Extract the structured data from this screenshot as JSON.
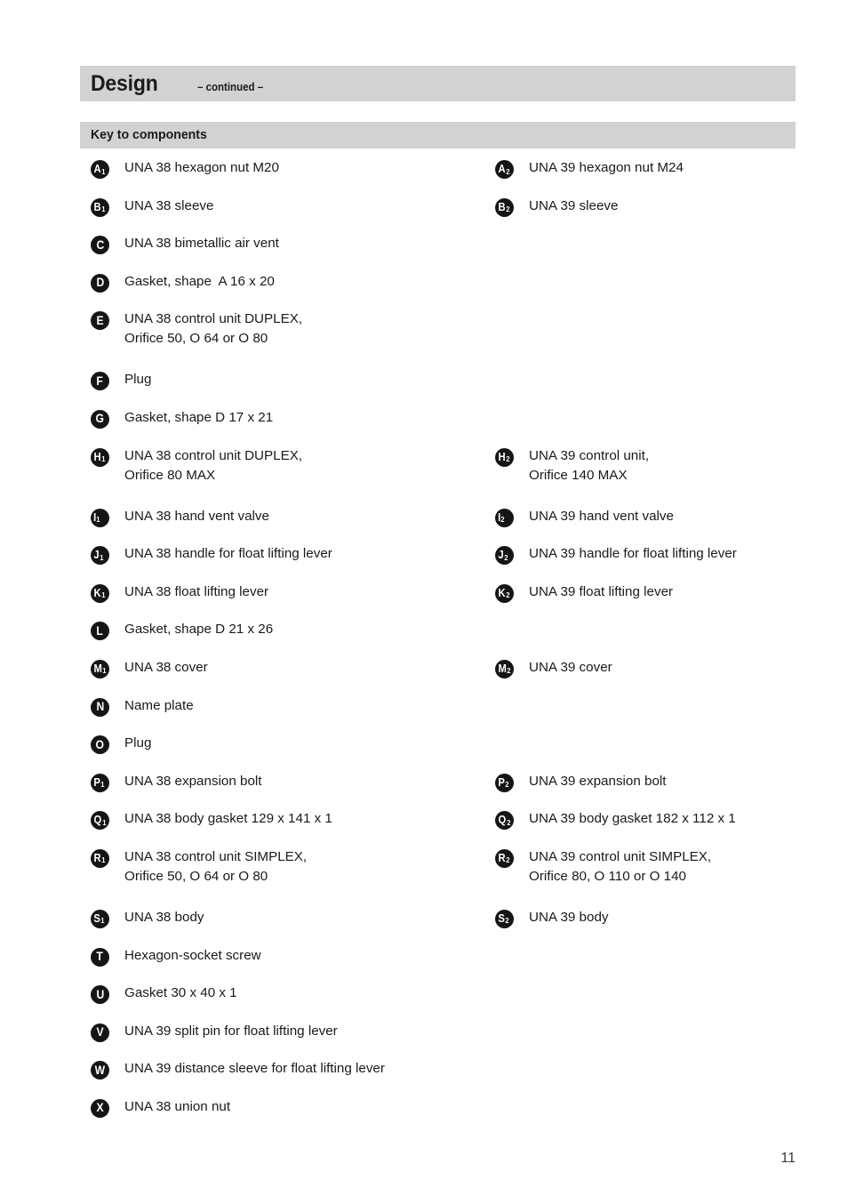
{
  "header": {
    "title": "Design",
    "continued": "– continued –",
    "section_title": "Key to components",
    "band_color": "#d2d2d2"
  },
  "footer": {
    "page_number": "11"
  },
  "key_to_components": {
    "rows": [
      {
        "left": {
          "letter": "A",
          "sub": "1",
          "lines": [
            "UNA 38 hexagon nut M20"
          ]
        },
        "right": {
          "letter": "A",
          "sub": "2",
          "lines": [
            "UNA 39 hexagon nut M24"
          ]
        }
      },
      {
        "left": {
          "letter": "B",
          "sub": "1",
          "lines": [
            "UNA 38 sleeve"
          ]
        },
        "right": {
          "letter": "B",
          "sub": "2",
          "lines": [
            "UNA 39 sleeve"
          ]
        }
      },
      {
        "left": {
          "letter": "C",
          "sub": "",
          "lines": [
            "UNA 38 bimetallic air vent"
          ]
        },
        "right": null
      },
      {
        "left": {
          "letter": "D",
          "sub": "",
          "lines": [
            "Gasket, shape  A 16 x 20"
          ]
        },
        "right": null
      },
      {
        "left": {
          "letter": "E",
          "sub": "",
          "lines": [
            "UNA 38 control unit DUPLEX,",
            "Orifice 50, O 64 or O 80"
          ]
        },
        "right": null
      },
      {
        "left": {
          "letter": "F",
          "sub": "",
          "lines": [
            "Plug"
          ]
        },
        "right": null
      },
      {
        "left": {
          "letter": "G",
          "sub": "",
          "lines": [
            "Gasket, shape D 17 x 21"
          ]
        },
        "right": null
      },
      {
        "left": {
          "letter": "H",
          "sub": "1",
          "lines": [
            "UNA 38 control unit DUPLEX,",
            "Orifice 80 MAX"
          ]
        },
        "right": {
          "letter": "H",
          "sub": "2",
          "lines": [
            "UNA 39 control unit,",
            "Orifice 140 MAX"
          ]
        }
      },
      {
        "left": {
          "letter": "I",
          "sub": "1",
          "lines": [
            "UNA 38 hand vent valve"
          ]
        },
        "right": {
          "letter": "I",
          "sub": "2",
          "lines": [
            "UNA 39 hand vent valve"
          ]
        }
      },
      {
        "left": {
          "letter": "J",
          "sub": "1",
          "lines": [
            "UNA 38 handle for float lifting lever"
          ]
        },
        "right": {
          "letter": "J",
          "sub": "2",
          "lines": [
            "UNA 39 handle for float lifting lever"
          ]
        }
      },
      {
        "left": {
          "letter": "K",
          "sub": "1",
          "lines": [
            "UNA 38 float lifting lever"
          ]
        },
        "right": {
          "letter": "K",
          "sub": "2",
          "lines": [
            "UNA 39 float lifting lever"
          ]
        }
      },
      {
        "left": {
          "letter": "L",
          "sub": "",
          "lines": [
            "Gasket, shape D 21 x 26"
          ]
        },
        "right": null
      },
      {
        "left": {
          "letter": "M",
          "sub": "1",
          "lines": [
            "UNA 38 cover"
          ]
        },
        "right": {
          "letter": "M",
          "sub": "2",
          "lines": [
            "UNA 39 cover"
          ]
        }
      },
      {
        "left": {
          "letter": "N",
          "sub": "",
          "lines": [
            "Name plate"
          ]
        },
        "right": null
      },
      {
        "left": {
          "letter": "O",
          "sub": "",
          "lines": [
            "Plug"
          ]
        },
        "right": null
      },
      {
        "left": {
          "letter": "P",
          "sub": "1",
          "lines": [
            "UNA 38 expansion bolt"
          ]
        },
        "right": {
          "letter": "P",
          "sub": "2",
          "lines": [
            "UNA 39 expansion bolt"
          ]
        }
      },
      {
        "left": {
          "letter": "Q",
          "sub": "1",
          "lines": [
            "UNA 38 body gasket 129 x 141 x 1"
          ]
        },
        "right": {
          "letter": "Q",
          "sub": "2",
          "lines": [
            "UNA 39 body gasket 182 x 112 x 1"
          ]
        }
      },
      {
        "left": {
          "letter": "R",
          "sub": "1",
          "lines": [
            "UNA 38 control unit SIMPLEX,",
            "Orifice 50, O 64 or O 80"
          ]
        },
        "right": {
          "letter": "R",
          "sub": "2",
          "lines": [
            "UNA 39 control unit SIMPLEX,",
            "Orifice 80, O 110 or O 140"
          ]
        }
      },
      {
        "left": {
          "letter": "S",
          "sub": "1",
          "lines": [
            "UNA 38 body"
          ]
        },
        "right": {
          "letter": "S",
          "sub": "2",
          "lines": [
            "UNA 39 body"
          ]
        }
      },
      {
        "left": {
          "letter": "T",
          "sub": "",
          "lines": [
            "Hexagon-socket screw"
          ]
        },
        "right": null
      },
      {
        "left": {
          "letter": "U",
          "sub": "",
          "lines": [
            "Gasket 30 x 40 x 1"
          ]
        },
        "right": null
      },
      {
        "left": {
          "letter": "V",
          "sub": "",
          "lines": [
            "UNA 39 split pin for float lifting lever"
          ]
        },
        "right": null
      },
      {
        "left": {
          "letter": "W",
          "sub": "",
          "lines": [
            "UNA 39 distance sleeve for float lifting lever"
          ]
        },
        "right": null
      },
      {
        "left": {
          "letter": "X",
          "sub": "",
          "lines": [
            "UNA 38 union nut"
          ]
        },
        "right": null
      }
    ]
  }
}
